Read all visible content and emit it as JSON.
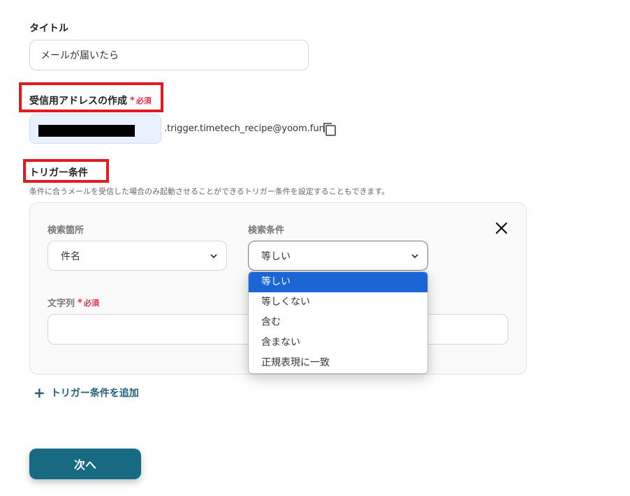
{
  "title_section": {
    "label": "タイトル",
    "value": "メールが届いたら"
  },
  "address_section": {
    "label": "受信用アドレスの作成",
    "required": "必須",
    "domain_suffix": ".trigger.timetech_recipe@yoom.fun",
    "copy_icon": "copy-icon"
  },
  "trigger_section": {
    "label": "トリガー条件",
    "description": "条件に合うメールを受信した場合のみ起動させることができるトリガー条件を設定することもできます。",
    "search_location_label": "検索箇所",
    "search_location_value": "件名",
    "search_condition_label": "検索条件",
    "search_condition_value": "等しい",
    "string_label": "文字列",
    "string_required": "必須",
    "string_value": "",
    "dropdown_options": [
      "等しい",
      "等しくない",
      "含む",
      "含まない",
      "正規表現に一致"
    ],
    "add_condition": "トリガー条件を追加"
  },
  "next_button": "次へ",
  "colors": {
    "accent": "#176a82",
    "required": "#e0334a",
    "highlight": "#e4181f",
    "selected_option": "#1a66d6"
  }
}
